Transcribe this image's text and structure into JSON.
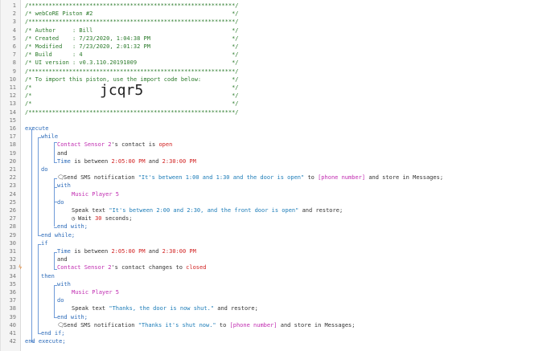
{
  "header_comments": [
    "/*************************************************************/",
    "/* webCoRE Piston #2                                         */",
    "/*************************************************************/",
    "/* Author     : Bill                                         */",
    "/* Created    : 7/23/2020, 1:04:38 PM                        */",
    "/* Modified   : 7/23/2020, 2:01:32 PM                        */",
    "/* Build      : 4                                            */",
    "/* UI version : v0.3.110.20191009                            */",
    "/*************************************************************/",
    "/* To import this piston, use the import code below:         */",
    "/*                                                           */",
    "/*                                                           */",
    "/*                                                           */",
    "/*************************************************************/"
  ],
  "import_code": "jcqr5",
  "code": {
    "execute": "execute",
    "while": "while",
    "cond1_dev": "Contact Sensor 2",
    "cond1_mid": "'s contact is ",
    "cond1_val": "open",
    "and": "and",
    "time_pre": "Time",
    "time_mid": " is between ",
    "t1": "2:05:00 PM",
    "and2": " and ",
    "t2": "2:30:00 PM",
    "do": "do",
    "sms1_pre": "Send SMS notification ",
    "sms1_msg": "\"It's between 1:00 and 1:30 and the door is open\"",
    "to": " to ",
    "phone": "[phone number]",
    "sms_store": " and store in Messages;",
    "with": "with",
    "music": "Music Player 5",
    "speak1_pre": "Speak text ",
    "speak1_msg": "\"It's between 2:00 and 2:30, and the front door is open\"",
    "speak_restore": " and restore;",
    "wait_pre": "Wait ",
    "wait_val": "30",
    "wait_post": " seconds;",
    "end_with": "end with;",
    "end_while": "end while;",
    "if": "if",
    "cond2_mid": "'s contact changes to ",
    "cond2_val": "closed",
    "then": "then",
    "speak2_msg": "\"Thanks, the door is now shut.\"",
    "sms2_msg": "\"Thanks it's shut now.\"",
    "end_if": "end if;",
    "end_execute": "end execute;"
  },
  "line_numbers": [
    "1",
    "2",
    "3",
    "4",
    "5",
    "6",
    "7",
    "8",
    "9",
    "10",
    "11",
    "12",
    "13",
    "14",
    "15",
    "16",
    "17",
    "18",
    "19",
    "20",
    "21",
    "22",
    "23",
    "24",
    "25",
    "26",
    "27",
    "28",
    "29",
    "30",
    "31",
    "32",
    "33",
    "34",
    "35",
    "36",
    "37",
    "38",
    "39",
    "40",
    "41",
    "42"
  ],
  "colors": {
    "comment": "#2a7a2a",
    "keyword": "#2b6ab8",
    "device": "#c02bb0",
    "value": "#d11f1f",
    "guide": "#6f9bd8"
  },
  "icons": {
    "sms": "comment-icon",
    "wait": "clock-icon",
    "flag": "lightning-icon"
  }
}
